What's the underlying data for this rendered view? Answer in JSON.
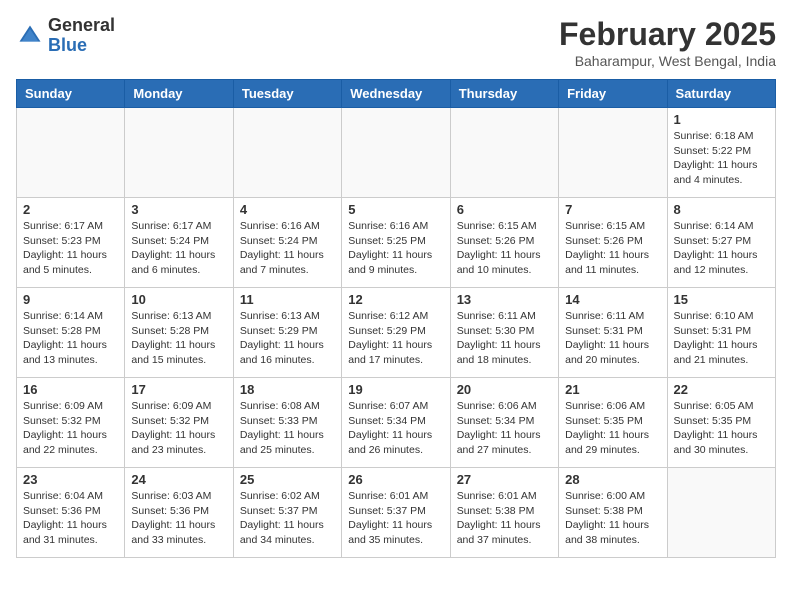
{
  "header": {
    "logo_general": "General",
    "logo_blue": "Blue",
    "month_title": "February 2025",
    "location": "Baharampur, West Bengal, India"
  },
  "days_of_week": [
    "Sunday",
    "Monday",
    "Tuesday",
    "Wednesday",
    "Thursday",
    "Friday",
    "Saturday"
  ],
  "weeks": [
    [
      {
        "day": "",
        "info": ""
      },
      {
        "day": "",
        "info": ""
      },
      {
        "day": "",
        "info": ""
      },
      {
        "day": "",
        "info": ""
      },
      {
        "day": "",
        "info": ""
      },
      {
        "day": "",
        "info": ""
      },
      {
        "day": "1",
        "info": "Sunrise: 6:18 AM\nSunset: 5:22 PM\nDaylight: 11 hours\nand 4 minutes."
      }
    ],
    [
      {
        "day": "2",
        "info": "Sunrise: 6:17 AM\nSunset: 5:23 PM\nDaylight: 11 hours\nand 5 minutes."
      },
      {
        "day": "3",
        "info": "Sunrise: 6:17 AM\nSunset: 5:24 PM\nDaylight: 11 hours\nand 6 minutes."
      },
      {
        "day": "4",
        "info": "Sunrise: 6:16 AM\nSunset: 5:24 PM\nDaylight: 11 hours\nand 7 minutes."
      },
      {
        "day": "5",
        "info": "Sunrise: 6:16 AM\nSunset: 5:25 PM\nDaylight: 11 hours\nand 9 minutes."
      },
      {
        "day": "6",
        "info": "Sunrise: 6:15 AM\nSunset: 5:26 PM\nDaylight: 11 hours\nand 10 minutes."
      },
      {
        "day": "7",
        "info": "Sunrise: 6:15 AM\nSunset: 5:26 PM\nDaylight: 11 hours\nand 11 minutes."
      },
      {
        "day": "8",
        "info": "Sunrise: 6:14 AM\nSunset: 5:27 PM\nDaylight: 11 hours\nand 12 minutes."
      }
    ],
    [
      {
        "day": "9",
        "info": "Sunrise: 6:14 AM\nSunset: 5:28 PM\nDaylight: 11 hours\nand 13 minutes."
      },
      {
        "day": "10",
        "info": "Sunrise: 6:13 AM\nSunset: 5:28 PM\nDaylight: 11 hours\nand 15 minutes."
      },
      {
        "day": "11",
        "info": "Sunrise: 6:13 AM\nSunset: 5:29 PM\nDaylight: 11 hours\nand 16 minutes."
      },
      {
        "day": "12",
        "info": "Sunrise: 6:12 AM\nSunset: 5:29 PM\nDaylight: 11 hours\nand 17 minutes."
      },
      {
        "day": "13",
        "info": "Sunrise: 6:11 AM\nSunset: 5:30 PM\nDaylight: 11 hours\nand 18 minutes."
      },
      {
        "day": "14",
        "info": "Sunrise: 6:11 AM\nSunset: 5:31 PM\nDaylight: 11 hours\nand 20 minutes."
      },
      {
        "day": "15",
        "info": "Sunrise: 6:10 AM\nSunset: 5:31 PM\nDaylight: 11 hours\nand 21 minutes."
      }
    ],
    [
      {
        "day": "16",
        "info": "Sunrise: 6:09 AM\nSunset: 5:32 PM\nDaylight: 11 hours\nand 22 minutes."
      },
      {
        "day": "17",
        "info": "Sunrise: 6:09 AM\nSunset: 5:32 PM\nDaylight: 11 hours\nand 23 minutes."
      },
      {
        "day": "18",
        "info": "Sunrise: 6:08 AM\nSunset: 5:33 PM\nDaylight: 11 hours\nand 25 minutes."
      },
      {
        "day": "19",
        "info": "Sunrise: 6:07 AM\nSunset: 5:34 PM\nDaylight: 11 hours\nand 26 minutes."
      },
      {
        "day": "20",
        "info": "Sunrise: 6:06 AM\nSunset: 5:34 PM\nDaylight: 11 hours\nand 27 minutes."
      },
      {
        "day": "21",
        "info": "Sunrise: 6:06 AM\nSunset: 5:35 PM\nDaylight: 11 hours\nand 29 minutes."
      },
      {
        "day": "22",
        "info": "Sunrise: 6:05 AM\nSunset: 5:35 PM\nDaylight: 11 hours\nand 30 minutes."
      }
    ],
    [
      {
        "day": "23",
        "info": "Sunrise: 6:04 AM\nSunset: 5:36 PM\nDaylight: 11 hours\nand 31 minutes."
      },
      {
        "day": "24",
        "info": "Sunrise: 6:03 AM\nSunset: 5:36 PM\nDaylight: 11 hours\nand 33 minutes."
      },
      {
        "day": "25",
        "info": "Sunrise: 6:02 AM\nSunset: 5:37 PM\nDaylight: 11 hours\nand 34 minutes."
      },
      {
        "day": "26",
        "info": "Sunrise: 6:01 AM\nSunset: 5:37 PM\nDaylight: 11 hours\nand 35 minutes."
      },
      {
        "day": "27",
        "info": "Sunrise: 6:01 AM\nSunset: 5:38 PM\nDaylight: 11 hours\nand 37 minutes."
      },
      {
        "day": "28",
        "info": "Sunrise: 6:00 AM\nSunset: 5:38 PM\nDaylight: 11 hours\nand 38 minutes."
      },
      {
        "day": "",
        "info": ""
      }
    ]
  ]
}
